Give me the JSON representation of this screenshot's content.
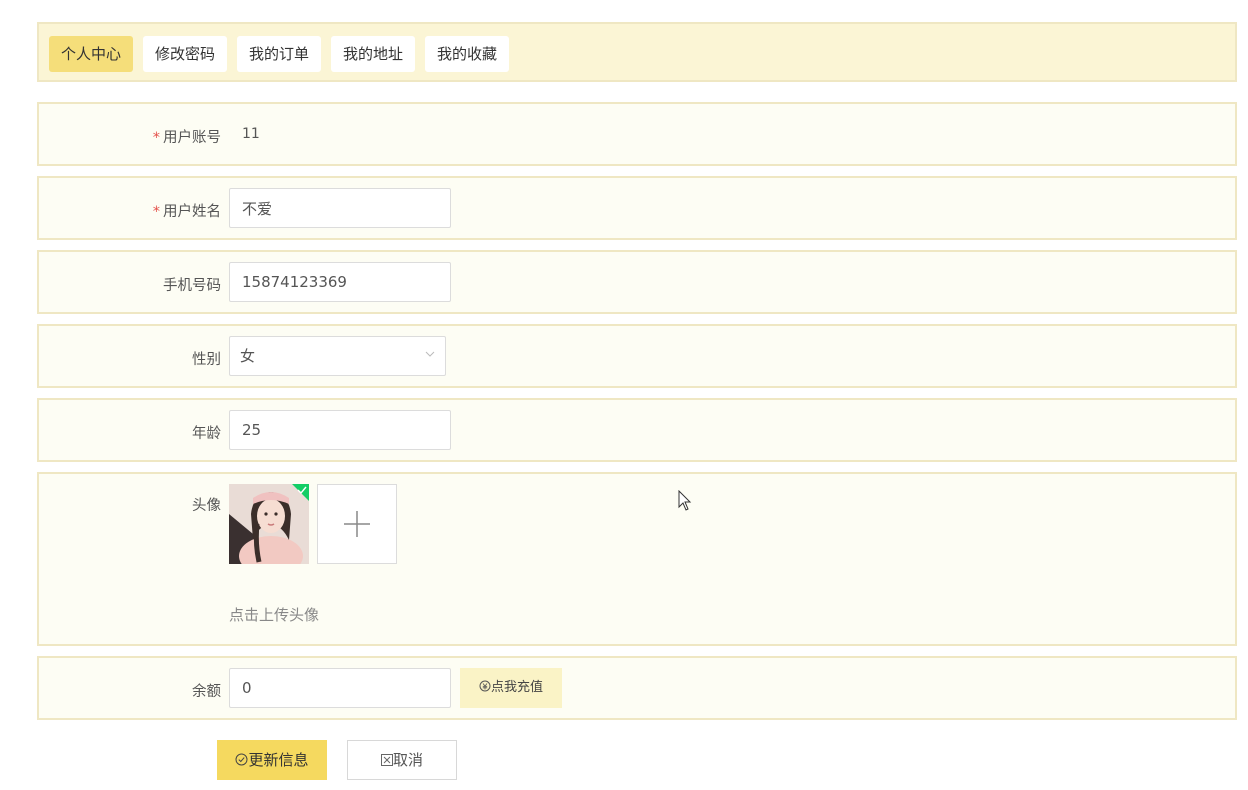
{
  "tabs": [
    {
      "label": "个人中心",
      "active": true
    },
    {
      "label": "修改密码",
      "active": false
    },
    {
      "label": "我的订单",
      "active": false
    },
    {
      "label": "我的地址",
      "active": false
    },
    {
      "label": "我的收藏",
      "active": false
    }
  ],
  "form": {
    "account": {
      "label": "用户账号",
      "required": "*",
      "value": "11"
    },
    "name": {
      "label": "用户姓名",
      "required": "*",
      "value": "不爱"
    },
    "phone": {
      "label": "手机号码",
      "value": "15874123369"
    },
    "gender": {
      "label": "性别",
      "value": "女"
    },
    "age": {
      "label": "年龄",
      "value": "25"
    },
    "avatar": {
      "label": "头像",
      "hint": "点击上传头像",
      "upload_icon": "plus-icon",
      "status_icon": "check-icon"
    },
    "balance": {
      "label": "余额",
      "value": "0",
      "recharge_label": "点我充值",
      "recharge_icon": "coin-icon"
    }
  },
  "actions": {
    "update_label": "更新信息",
    "update_icon": "check-circle-icon",
    "cancel_label": "取消",
    "cancel_icon": "close-box-icon"
  },
  "colors": {
    "accent": "#f5d95f",
    "tab_active": "#f5de7a",
    "row_bg": "#fdfdf4",
    "row_border": "#efe7c3",
    "required": "#e4504a",
    "success": "#13ce66"
  }
}
